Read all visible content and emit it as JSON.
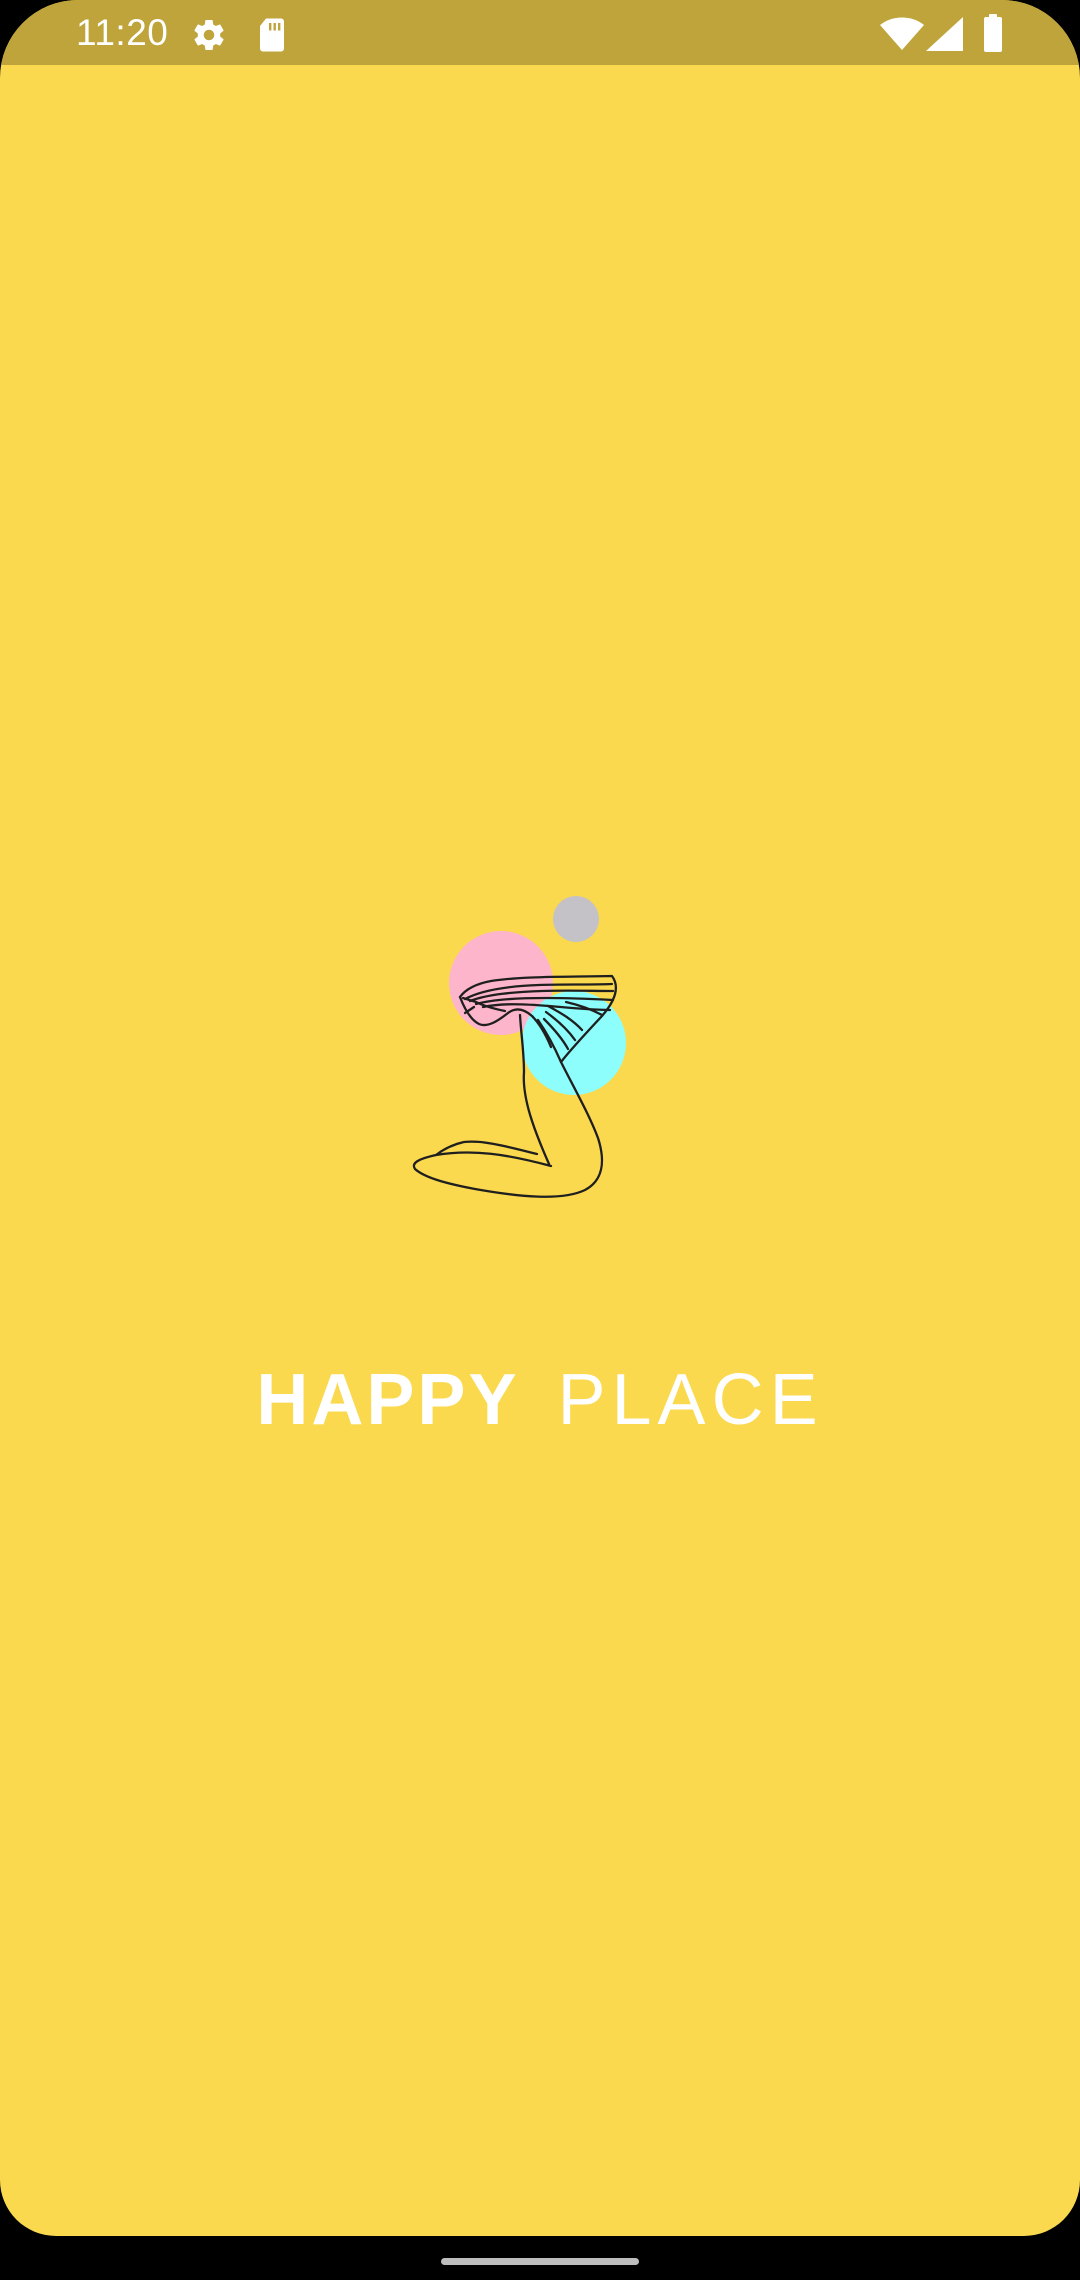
{
  "status_bar": {
    "time": "11:20",
    "left_icons": [
      "gear-icon",
      "sd-card-icon"
    ],
    "right_icons": [
      "wifi-icon",
      "cellular-signal-icon",
      "battery-icon"
    ]
  },
  "splash": {
    "title_bold": "HAPPY",
    "title_light": "PLACE",
    "logo_icon": "happy-place-logo-icon"
  },
  "colors": {
    "background": "#FAD94F",
    "status_bar": "#BFA43B",
    "title_text": "#FFFFFF",
    "logo_pink": "#FDB5CC",
    "logo_cyan": "#8DFEFC",
    "logo_gray": "#C4C2C7",
    "nav_bar": "#000000",
    "gesture_pill": "#BDBDBD"
  },
  "navigation": {
    "gesture_bar": "gesture-handle"
  }
}
